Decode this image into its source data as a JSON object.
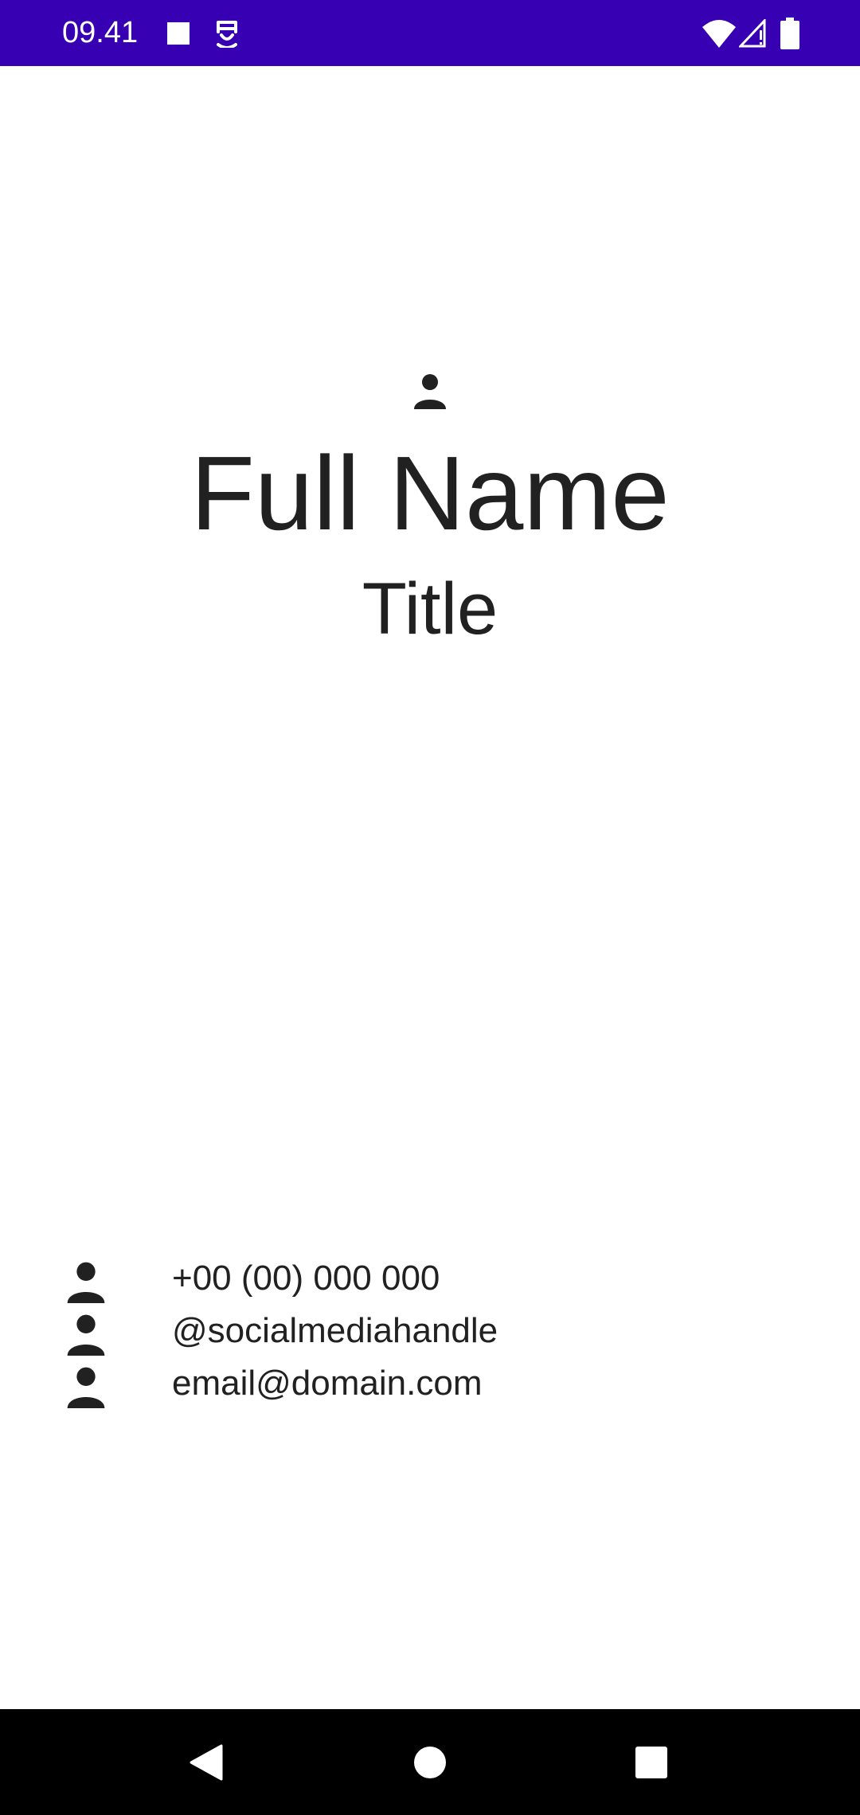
{
  "status_bar": {
    "time": "09.41",
    "background": "#3700b3",
    "icons": [
      "notification-square-icon",
      "app-notification-icon",
      "wifi-icon",
      "cellular-signal-icon",
      "battery-icon"
    ]
  },
  "profile": {
    "icon": "person-icon",
    "full_name": "Full Name",
    "title": "Title"
  },
  "contacts": [
    {
      "icon": "person-icon",
      "text": "+00 (00) 000 000"
    },
    {
      "icon": "person-icon",
      "text": "@socialmediahandle"
    },
    {
      "icon": "person-icon",
      "text": "email@domain.com"
    }
  ],
  "nav_bar": {
    "buttons": [
      "back-button",
      "home-button",
      "recents-button"
    ]
  },
  "colors": {
    "accent": "#3700b3",
    "text": "#212121",
    "background": "#ffffff"
  }
}
